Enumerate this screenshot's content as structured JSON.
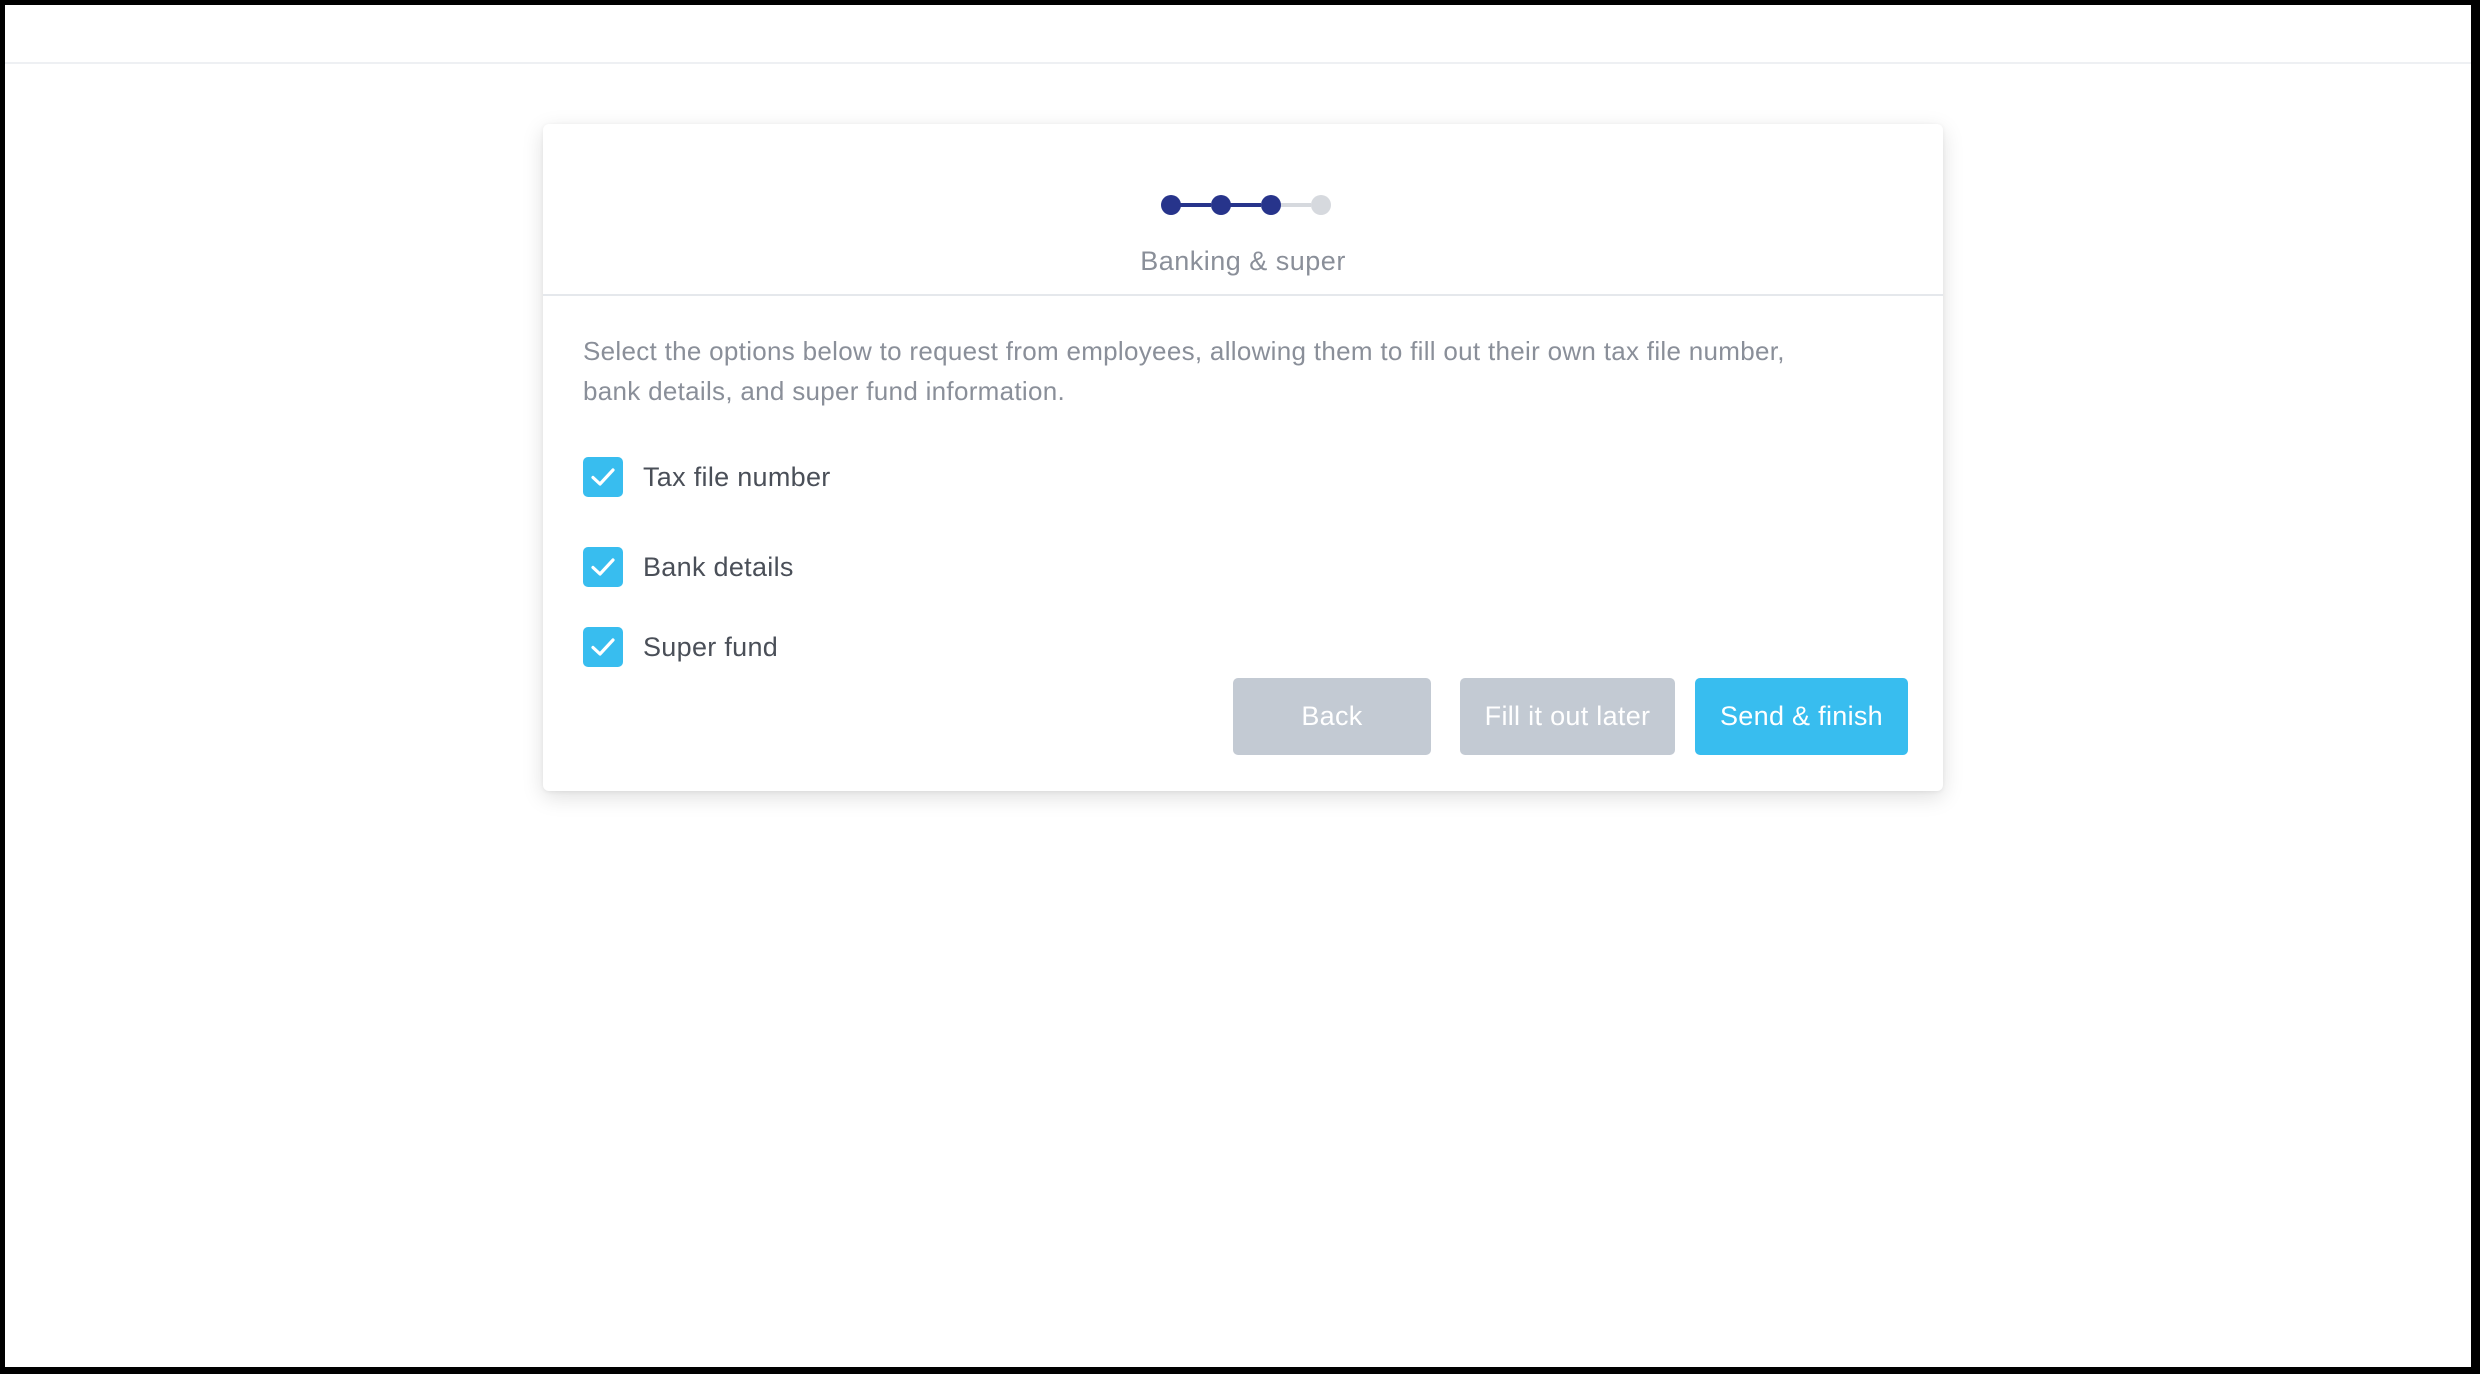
{
  "theme": {
    "accent": "#38bdef",
    "step_complete": "#27348b",
    "step_incomplete": "#d6d9de",
    "muted_text": "#8a8f99",
    "label_text": "#4a4f58",
    "disabled_button": "#c3cad3",
    "disabled_button_text": "#ffffff",
    "primary_button_text": "#ffffff"
  },
  "wizard": {
    "steps_total": 4,
    "current_step": 3,
    "step_title": "Banking & super"
  },
  "content": {
    "intro_line1": "Select the options below to request from employees, allowing them to fill out their own tax file number,",
    "intro_line2": "bank details, and super fund information."
  },
  "options": [
    {
      "label": "Tax file number",
      "checked": true
    },
    {
      "label": "Bank details",
      "checked": true
    },
    {
      "label": "Super fund",
      "checked": true
    }
  ],
  "icons": {
    "checkbox_check": "check-icon"
  },
  "buttons": {
    "back": "Back",
    "fill_later": "Fill it out later",
    "send_finish": "Send & finish"
  }
}
